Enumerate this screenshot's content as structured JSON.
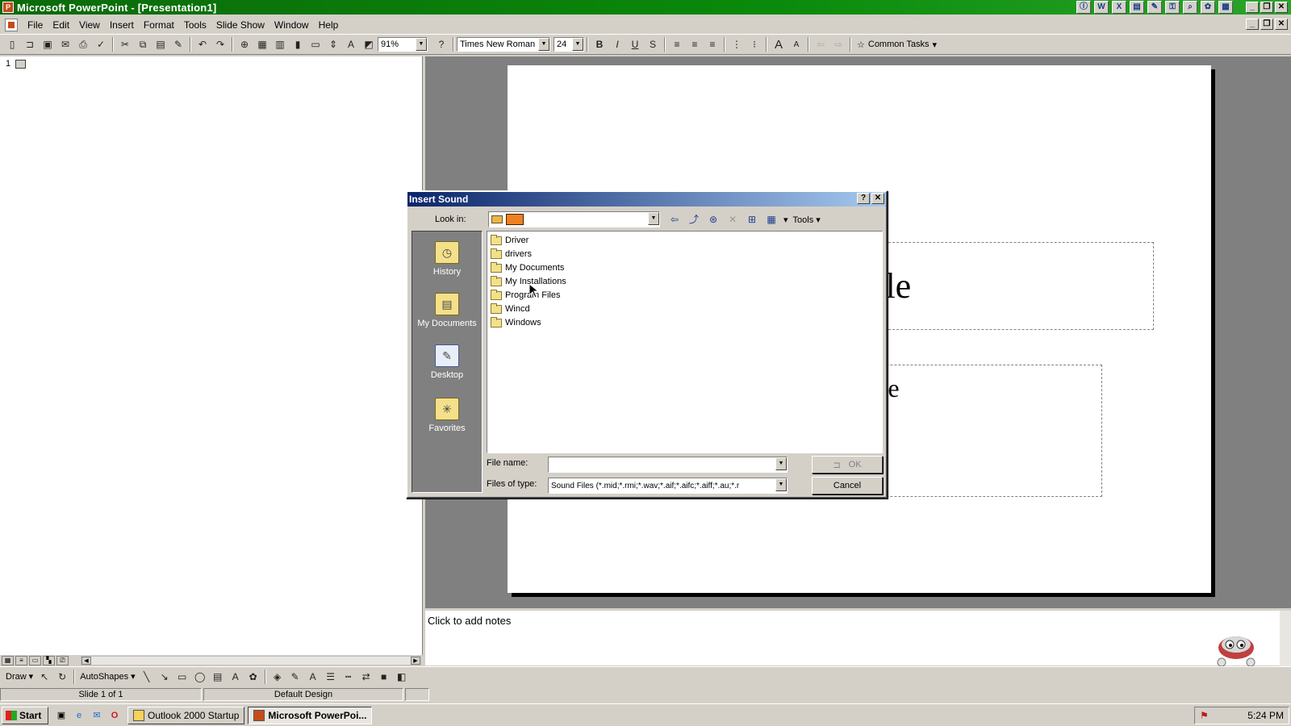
{
  "window": {
    "title": "Microsoft PowerPoint - [Presentation1]",
    "controls": [
      "_",
      "❐",
      "✕"
    ],
    "mdi_controls": [
      "_",
      "❐",
      "✕"
    ],
    "tray_icons": [
      "Ⓘ",
      "W",
      "X",
      "▤",
      "✎",
      "⚿",
      "⌕",
      "✿",
      "▦"
    ]
  },
  "menu": {
    "items": [
      "File",
      "Edit",
      "View",
      "Insert",
      "Format",
      "Tools",
      "Slide Show",
      "Window",
      "Help"
    ]
  },
  "toolbar": {
    "zoom": "91%",
    "font": "Times New Roman",
    "font_size": "24",
    "common_tasks": "Common Tasks",
    "help_glyph": "?"
  },
  "outline": {
    "slide_number": "1"
  },
  "slide": {
    "title_placeholder": "dd title",
    "subtitle_placeholder": "subtitle"
  },
  "notes": {
    "placeholder": "Click to add notes"
  },
  "drawbar": {
    "draw_label": "Draw",
    "autoshapes_label": "AutoShapes"
  },
  "status": {
    "slide": "Slide 1 of 1",
    "design": "Default Design"
  },
  "taskbar": {
    "start_label": "Start",
    "tasks": [
      "Outlook 2000 Startup",
      "Microsoft PowerPoi..."
    ],
    "clock": "5:24 PM"
  },
  "dialog": {
    "title": "Insert Sound",
    "look_in_label": "Look in:",
    "tools_label": "Tools",
    "places": [
      "History",
      "My Documents",
      "Desktop",
      "Favorites"
    ],
    "files": [
      "Driver",
      "drivers",
      "My Documents",
      "My Installations",
      "Program Files",
      "Wincd",
      "Windows"
    ],
    "file_name_label": "File name:",
    "file_name_value": "",
    "files_of_type_label": "Files of type:",
    "files_of_type_value": "Sound Files (*.mid;*.rmi;*.wav;*.aif;*.aifc;*.aiff;*.au;*.r",
    "ok_label": "OK",
    "cancel_label": "Cancel"
  }
}
